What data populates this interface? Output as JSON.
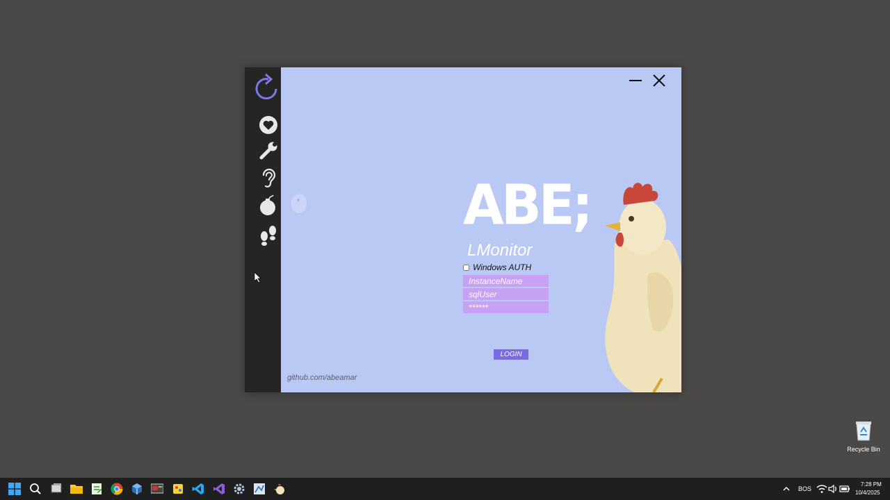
{
  "app": {
    "logo_text": "ABE;",
    "subtitle": "LMonitor",
    "auth_label": "Windows AUTH",
    "instance_placeholder": "InstanceName",
    "user_placeholder": "sqlUser",
    "password_placeholder": "******",
    "login_label": "LOGIN",
    "footer_link": "github.com/abeamar"
  },
  "sidebar": {
    "items": [
      "refresh-icon",
      "heart-icon",
      "wrench-icon",
      "ear-icon",
      "bomb-icon",
      "footprints-icon"
    ]
  },
  "desktop": {
    "recycle_bin_label": "Recycle Bin"
  },
  "taskbar": {
    "language": "BOS",
    "time": "7:28 PM",
    "date": "10/4/2025"
  },
  "colors": {
    "desktop": "#4a4948",
    "sidebar": "#252623",
    "main_background": "#bac8f4",
    "field": "#c8a2f2",
    "login_button": "#7a6ae8",
    "refresh_accent": "#7b78e8"
  }
}
